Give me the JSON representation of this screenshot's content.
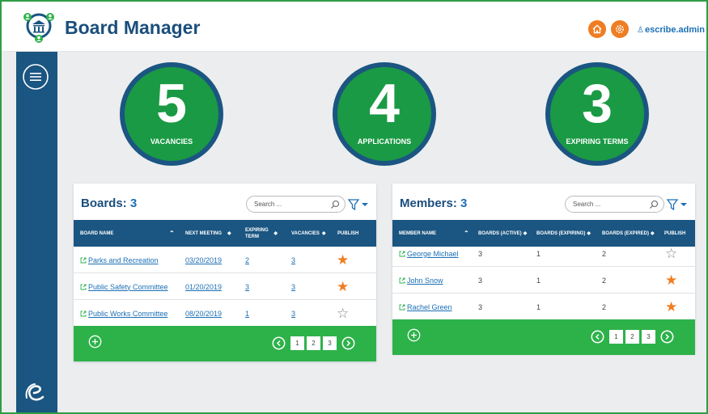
{
  "header": {
    "title": "Board Manager",
    "user": "escribe.admin",
    "home_icon": "home-icon",
    "settings_icon": "gear-icon",
    "accent_color": "#ef7d22"
  },
  "sidebar": {
    "menu_icon": "menu-icon",
    "brand_icon": "escribe-e-logo",
    "color": "#1b5581"
  },
  "stats": [
    {
      "value": "5",
      "label": "VACANCIES"
    },
    {
      "value": "4",
      "label": "APPLICATIONS"
    },
    {
      "value": "3",
      "label": "EXPIRING TERMS"
    }
  ],
  "boards": {
    "title": "Boards:",
    "count": "3",
    "search_placeholder": "Search ...",
    "columns": [
      "BOARD NAME",
      "NEXT MEETING",
      "EXPIRING TERM",
      "VACANCIES",
      "PUBLISH"
    ],
    "rows": [
      {
        "name": "Parks and Recreation",
        "next_meeting": "03/20/2019",
        "expiring": "2",
        "vacancies": "3",
        "published": true
      },
      {
        "name": "Public Safety Committee",
        "next_meeting": "01/20/2019",
        "expiring": "3",
        "vacancies": "3",
        "published": true
      },
      {
        "name": "Public Works Committee",
        "next_meeting": "08/20/2019",
        "expiring": "1",
        "vacancies": "3",
        "published": false
      }
    ],
    "pages": [
      "1",
      "2",
      "3"
    ]
  },
  "members": {
    "title": "Members:",
    "count": "3",
    "search_placeholder": "Search ...",
    "columns": [
      "MEMBER NAME",
      "BOARDS (ACTIVE)",
      "BOARDS (EXPIRING)",
      "BOARDS (EXPIRED)",
      "PUBLISH"
    ],
    "rows": [
      {
        "name": "George Michael",
        "active": "3",
        "expiring": "1",
        "expired": "2",
        "published": false
      },
      {
        "name": "John Snow",
        "active": "3",
        "expiring": "1",
        "expired": "2",
        "published": true
      },
      {
        "name": "Rachel Green",
        "active": "3",
        "expiring": "1",
        "expired": "2",
        "published": true
      }
    ],
    "pages": [
      "1",
      "2",
      "3"
    ]
  },
  "colors": {
    "stat_green": "#1a9a44",
    "footer_green": "#2db24a",
    "table_header": "#1b5581",
    "link": "#1b6fb5"
  }
}
